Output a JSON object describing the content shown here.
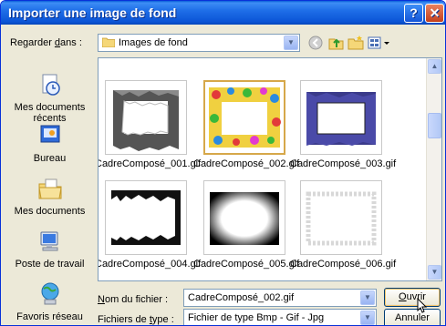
{
  "window": {
    "title": "Importer une image de fond",
    "help_label": "?",
    "close_label": "✕"
  },
  "lookin": {
    "label_pre": "Regarder ",
    "label_accel": "d",
    "label_post": "ans :",
    "value": "Images de fond"
  },
  "places": [
    {
      "label": "Mes documents récents",
      "icon": "recent-documents-icon"
    },
    {
      "label": "Bureau",
      "icon": "desktop-icon"
    },
    {
      "label": "Mes documents",
      "icon": "my-documents-icon"
    },
    {
      "label": "Poste de travail",
      "icon": "my-computer-icon"
    },
    {
      "label": "Favoris réseau",
      "icon": "network-places-icon"
    }
  ],
  "files": [
    {
      "name": "CadreComposé_001.gif",
      "selected": false
    },
    {
      "name": "CadreComposé_002.gif",
      "selected": true
    },
    {
      "name": "CadreComposé_003.gif",
      "selected": false
    },
    {
      "name": "CadreComposé_004.gif",
      "selected": false
    },
    {
      "name": "CadreComposé_005.gif",
      "selected": false
    },
    {
      "name": "CadreComposé_006.gif",
      "selected": false
    }
  ],
  "filename": {
    "label_pre": "",
    "label_accel": "N",
    "label_post": "om du fichier :",
    "value": "CadreComposé_002.gif"
  },
  "filetype": {
    "label_pre": "Fichiers de ",
    "label_accel": "t",
    "label_post": "ype :",
    "value": "Fichier de type Bmp - Gif - Jpg"
  },
  "buttons": {
    "open_accel": "O",
    "open_rest": "uvrir",
    "cancel": "Annuler"
  },
  "colors": {
    "titlebar": "#0b54d6",
    "dialog_bg": "#ece9d8",
    "selection_border": "#d6a84a"
  }
}
